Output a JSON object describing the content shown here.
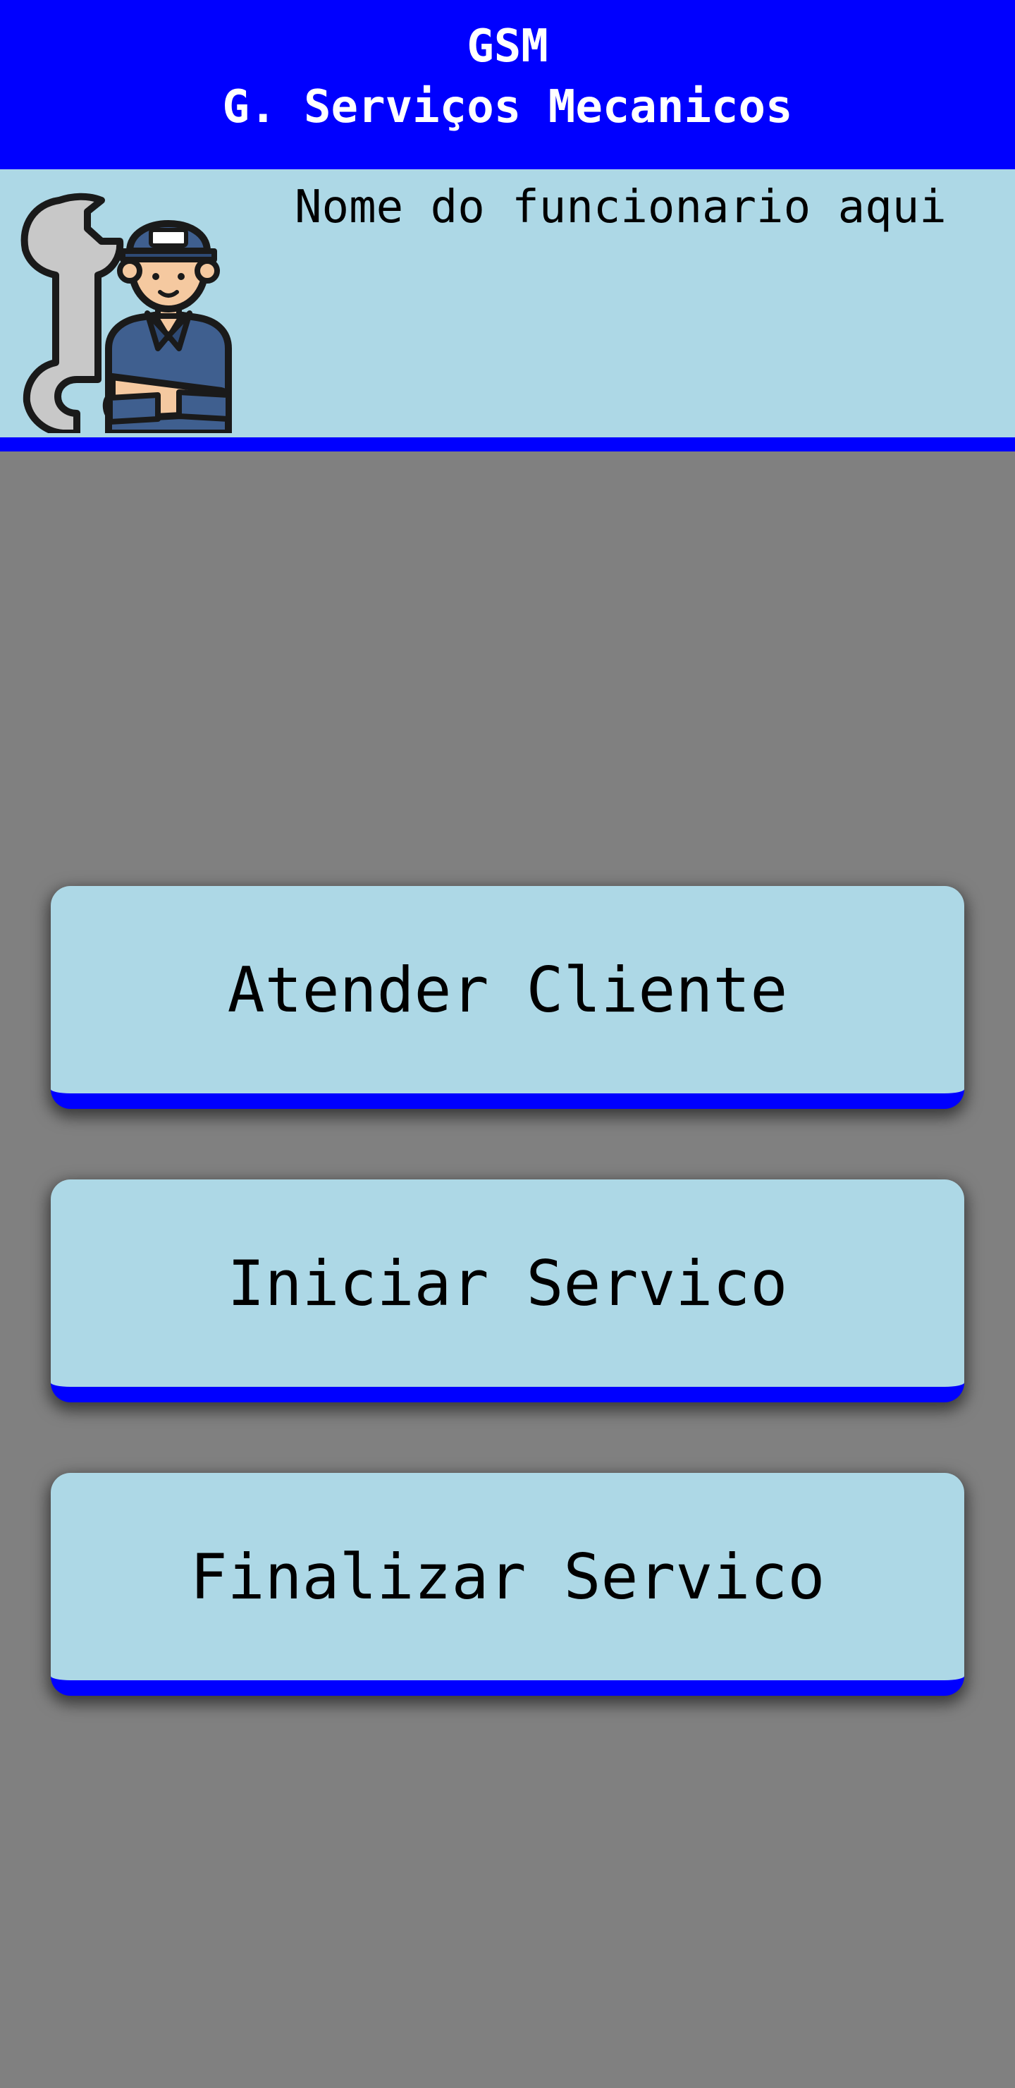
{
  "header": {
    "title": "GSM",
    "subtitle": "G. Serviços Mecanicos",
    "background_color": "#0000ff",
    "text_color": "#ffffff"
  },
  "profile": {
    "avatar_icon": "mechanic-with-wrench-icon",
    "employee_name": "Nome do funcionario aqui",
    "background_color": "#add8e6"
  },
  "menu": {
    "buttons": [
      {
        "label": "Atender Cliente"
      },
      {
        "label": "Iniciar Servico"
      },
      {
        "label": "Finalizar Servico"
      }
    ],
    "button_color": "#add8e6",
    "accent_color": "#0000ff"
  },
  "page_background": "#808080"
}
